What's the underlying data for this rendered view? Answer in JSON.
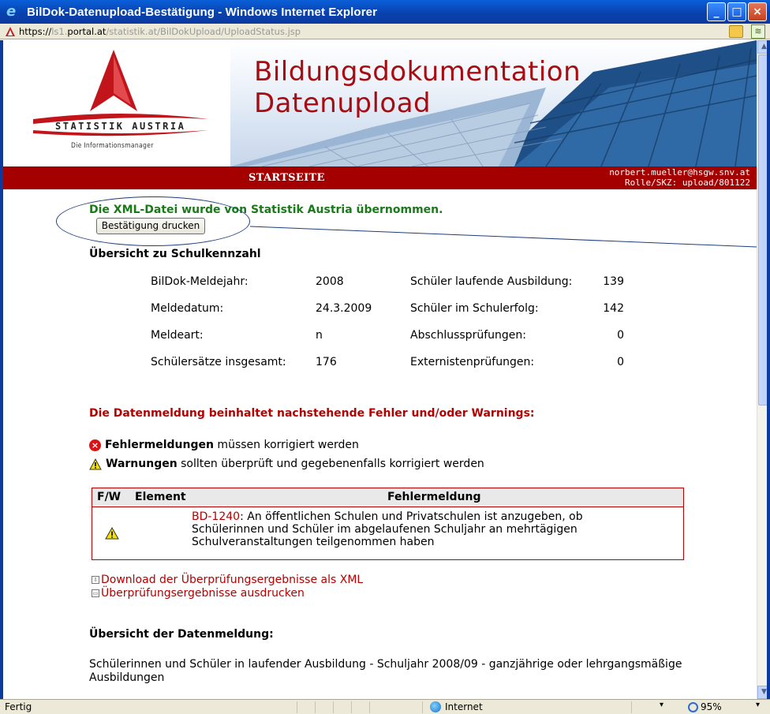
{
  "window": {
    "title": "BilDok-Datenupload-Bestätigung - Windows Internet Explorer",
    "minimize": "_",
    "maximize": "□",
    "close": "×"
  },
  "address": {
    "proto": "https://",
    "host_dim1": "ls1.",
    "host": "portal.at",
    "path_dim": "/statistik.at/BilDokUpload/UploadStatus.jsp"
  },
  "logo": {
    "name": "STATISTIK AUSTRIA",
    "tagline": "Die Informationsmanager"
  },
  "banner": {
    "title_line1": "Bildungsdokumentation",
    "title_line2": "Datenupload"
  },
  "nav": {
    "home": "STARTSEITE",
    "user": "norbert.mueller@hsgw.snv.at",
    "role": "Rolle/SKZ: upload/801122"
  },
  "content": {
    "success": "Die XML-Datei wurde von Statistik Austria übernommen.",
    "print_button": "Bestätigung drucken",
    "overview_heading": "Übersicht zu Schulkennzahl",
    "overview": [
      {
        "label1": "BilDok-Meldejahr:",
        "value1": "2008",
        "label2": "Schüler laufende Ausbildung:",
        "value2": "139"
      },
      {
        "label1": "Meldedatum:",
        "value1": "24.3.2009",
        "label2": "Schüler im Schulerfolg:",
        "value2": "142"
      },
      {
        "label1": "Meldeart:",
        "value1": "n",
        "label2": "Abschlussprüfungen:",
        "value2": "0"
      },
      {
        "label1": "Schülersätze insgesamt:",
        "value1": "176",
        "label2": "Externistenprüfungen:",
        "value2": "0"
      }
    ],
    "error_heading": "Die Datenmeldung beinhaltet nachstehende Fehler und/oder Warnings:",
    "legend_error_bold": "Fehlermeldungen",
    "legend_error_rest": " müssen korrigiert werden",
    "legend_warn_bold": "Warnungen",
    "legend_warn_rest": " sollten überprüft und gegebenenfalls korrigiert werden",
    "table_headers": {
      "fw": "F/W",
      "element": "Element",
      "message": "Fehlermeldung"
    },
    "table_rows": [
      {
        "code": "BD-1240",
        "message": ": An öffentlichen Schulen und Privatschulen ist anzugeben, ob Schülerinnen und Schüler im abgelaufenen Schuljahr an mehrtägigen Schulveranstaltungen teilgenommen haben"
      }
    ],
    "download_link": "Download der Überprüfungsergebnisse als XML",
    "print_link": "Überprüfungsergebnisse ausdrucken",
    "summary_heading": "Übersicht der Datenmeldung:",
    "summary_text": "Schülerinnen und Schüler in laufender Ausbildung - Schuljahr 2008/09 - ganzjährige oder lehrgangsmäßige Ausbildungen"
  },
  "status": {
    "text": "Fertig",
    "zone": "Internet",
    "zoom": "95%"
  },
  "colors": {
    "brand_red": "#a50000",
    "success_green": "#1a7a1a",
    "title_blue": "#0842b0"
  }
}
